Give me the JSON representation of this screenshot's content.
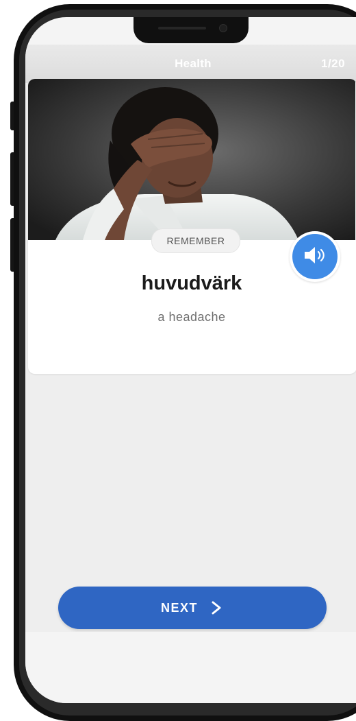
{
  "header": {
    "title": "Health",
    "counter": "1/20"
  },
  "card": {
    "badge": "REMEMBER",
    "word": "huvudvärk",
    "translation": "a headache",
    "image_icon": "photo-person-headache",
    "sound_icon": "speaker-icon"
  },
  "actions": {
    "next_label": "NEXT",
    "next_icon": "chevron-right-icon"
  },
  "colors": {
    "accent_blue": "#3f8be6",
    "button_blue": "#2f66c3",
    "background": "#eeeeee"
  }
}
